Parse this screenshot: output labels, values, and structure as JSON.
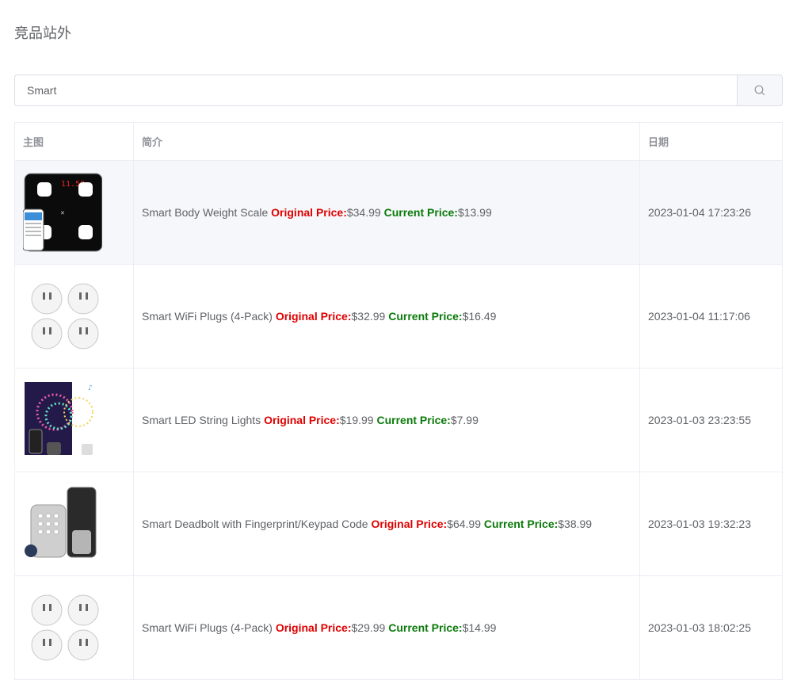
{
  "page": {
    "title": "竞品站外"
  },
  "search": {
    "value": "Smart",
    "button_icon": "search-icon"
  },
  "table": {
    "columns": [
      "主图",
      "简介",
      "日期"
    ],
    "rows": [
      {
        "image": "smart-scale-image",
        "name": "Smart Body Weight Scale",
        "orig_label": "Original Price:",
        "orig_price": "$34.99",
        "curr_label": "Current Price:",
        "curr_price": "$13.99",
        "date": "2023-01-04 17:23:26",
        "scale_display": "11.50"
      },
      {
        "image": "wifi-plugs-image",
        "name": "Smart WiFi Plugs (4-Pack)",
        "orig_label": "Original Price:",
        "orig_price": "$32.99",
        "curr_label": "Current Price:",
        "curr_price": "$16.49",
        "date": "2023-01-04 11:17:06"
      },
      {
        "image": "led-string-lights-image",
        "name": "Smart LED String Lights",
        "orig_label": "Original Price:",
        "orig_price": "$19.99",
        "curr_label": "Current Price:",
        "curr_price": "$7.99",
        "date": "2023-01-03 23:23:55"
      },
      {
        "image": "deadbolt-image",
        "name": "Smart Deadbolt with Fingerprint/Keypad Code",
        "orig_label": "Original Price:",
        "orig_price": "$64.99",
        "curr_label": "Current Price:",
        "curr_price": "$38.99",
        "date": "2023-01-03 19:32:23"
      },
      {
        "image": "wifi-plugs-image",
        "name": "Smart WiFi Plugs (4-Pack)",
        "orig_label": "Original Price:",
        "orig_price": "$29.99",
        "curr_label": "Current Price:",
        "curr_price": "$14.99",
        "date": "2023-01-03 18:02:25"
      }
    ]
  },
  "colors": {
    "original_price": "#e00000",
    "current_price": "#0a7a0a",
    "border": "#ebeef5",
    "header_text": "#909399"
  }
}
